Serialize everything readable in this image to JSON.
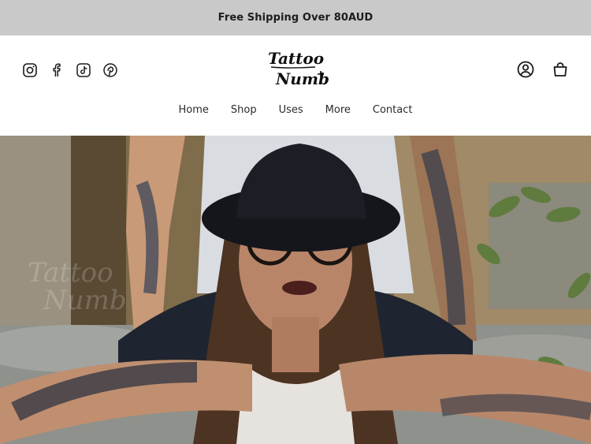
{
  "announcement": {
    "text": "Free Shipping Over 80AUD"
  },
  "social": [
    {
      "icon": "instagram-icon"
    },
    {
      "icon": "facebook-icon"
    },
    {
      "icon": "tiktok-icon"
    },
    {
      "icon": "pinterest-icon"
    }
  ],
  "logo": {
    "line1": "Tattoo",
    "line2": "Numb"
  },
  "header": {
    "account_icon": "user-icon",
    "cart_icon": "bag-icon"
  },
  "nav": {
    "items": [
      {
        "label": "Home"
      },
      {
        "label": "Shop"
      },
      {
        "label": "Uses"
      },
      {
        "label": "More"
      },
      {
        "label": "Contact"
      }
    ]
  },
  "hero": {
    "image": "woman-with-tattoos-hat-glasses"
  },
  "colors": {
    "announcement_bg": "#c9c9c9",
    "header_bg": "#ffffff",
    "text": "#1a1a1a"
  }
}
